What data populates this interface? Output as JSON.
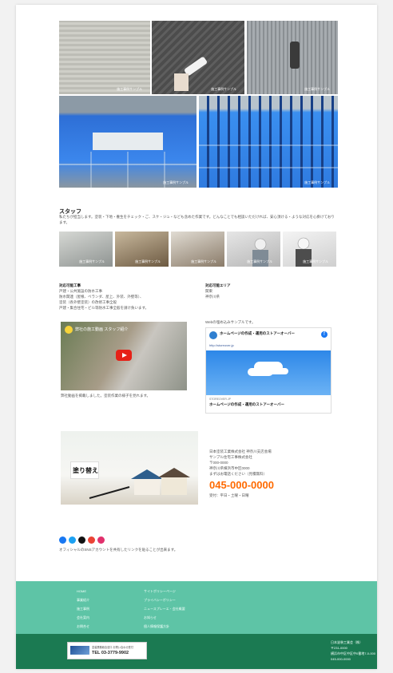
{
  "gallery": {
    "captions": [
      "施工事例サンプル",
      "施工事例サンプル",
      "施工事例サンプル",
      "施工事例サンプル",
      "施工事例サンプル"
    ]
  },
  "staff": {
    "title": "スタッフ",
    "description": "私たちが担当します。塗装・下地・養生をチェック・ご、スケ・ジュ・なども含めた作業です。どんなことでも相談いただければ、安心頂ける・ような対応を心掛けております。",
    "captions": [
      "施工事例サンプル",
      "施工事例サンプル",
      "施工事例サンプル",
      "施工事例サンプル",
      "施工事例サンプル"
    ]
  },
  "services": {
    "title": "対応可能工事",
    "lines": [
      "戸建・公共施設の防水工事",
      "防水関連（屋根、ベランダ、屋上、外装、外壁等）、",
      "塗装（各外壁塗装）の改修工事全般",
      "戸建・集合住宅・ビル等防水工事全般を請け負います。"
    ]
  },
  "area": {
    "title": "対応可能エリア",
    "lines": [
      "関東",
      "神奈川県"
    ]
  },
  "video": {
    "title": "弊社の施工動画 スタッフ紹介",
    "caption": "弊社動画を掲載しました。塗装作業の様子を見れます。"
  },
  "facebook": {
    "heading": "Webの埋め込みサンプルです。",
    "page_name": "ホームページの作成・運用のストアーオーバー",
    "url": "http://storeover.jp",
    "footer_small": "STOREOVER.JP",
    "footer_title": "ホームページの作成・運用のストアーオーバー"
  },
  "company": {
    "name": "日本塗装工業株式会社 神奈川支店会場",
    "line2": "サンプル住宅工事株式会社",
    "postal": "〒000-0000",
    "address": "神奈川県横浜市中区0000",
    "note": "まずはお電話ください（見積無料）",
    "phone": "045-000-0000",
    "hours": "受付：平日・土曜・日曜"
  },
  "promo": {
    "sign_text": "塗り替え"
  },
  "social": {
    "icons": [
      "facebook-icon",
      "twitter-icon",
      "tiktok-icon",
      "google-icon",
      "instagram-icon"
    ],
    "text": "オフィシャルのSNSアカウントを共有したリンクを貼ることが出来ます。"
  },
  "footer": {
    "col1": [
      "HOME",
      "事業紹介",
      "施工事例",
      "会社案内",
      "お問合せ"
    ],
    "col2": [
      "サイトポリシーページ",
      "プライバシーポリシー",
      "ニュースプレーエ・会社概要",
      "お知らせ",
      "個人情報保護方針"
    ],
    "banner_line1": "塗装業務総合窓口 お問い合わせ受付",
    "banner_tel": "TEL 03-3779-9902",
    "address_lines": [
      "日本塗装工業会（株）",
      "〒231-0000",
      "横浜市中区中区中0番地7-0-000",
      "045-000-0000"
    ]
  },
  "colors": {
    "accent_orange": "#ff6a00",
    "footer_green": "#5ec4a6",
    "bottom_green": "#1b7a52"
  }
}
